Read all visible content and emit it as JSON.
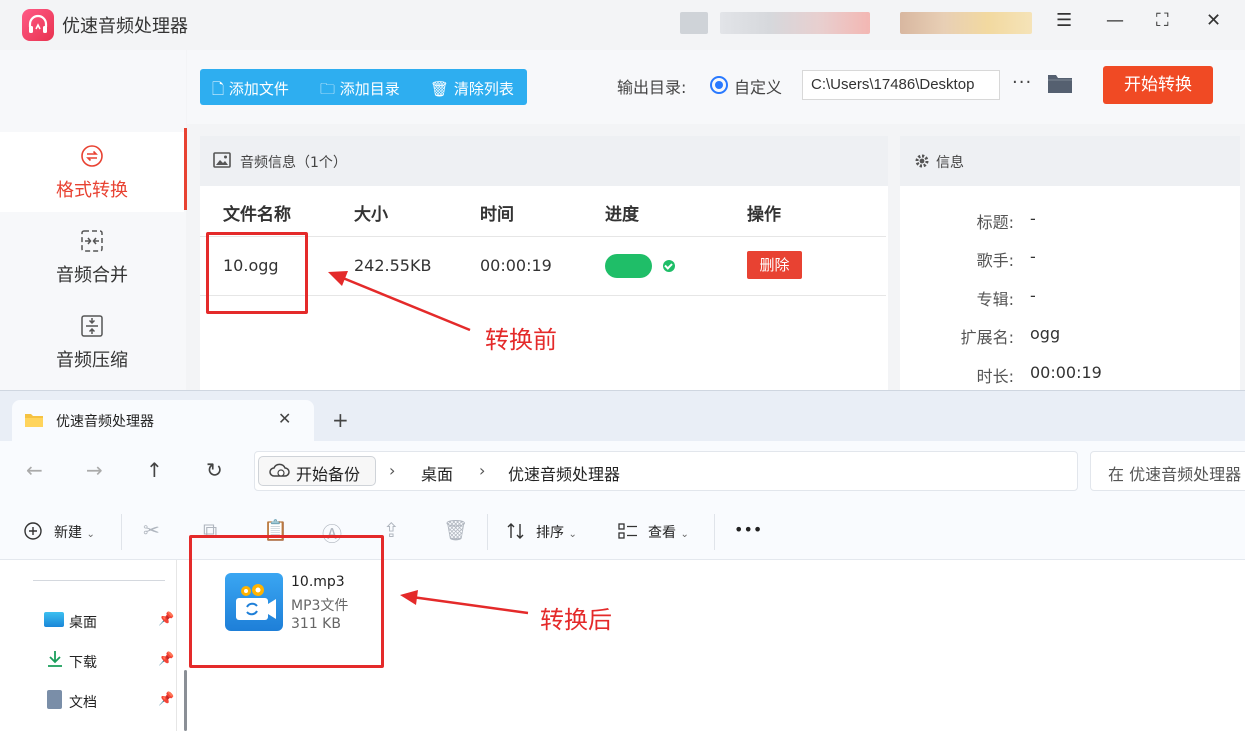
{
  "app": {
    "title": "优速音频处理器"
  },
  "sidebar": {
    "items": [
      {
        "label": "格式转换",
        "icon": "swap-circle-icon",
        "active": true
      },
      {
        "label": "音频合并",
        "icon": "merge-icon",
        "active": false
      },
      {
        "label": "音频压缩",
        "icon": "compress-icon",
        "active": false
      }
    ]
  },
  "toolbar": {
    "add_file": "添加文件",
    "add_dir": "添加目录",
    "clear_list": "清除列表",
    "output_label": "输出目录:",
    "radio_label": "自定义",
    "output_path": "C:\\Users\\17486\\Desktop",
    "more": "···",
    "start": "开始转换"
  },
  "audio_panel": {
    "title": "音频信息（1个）",
    "columns": [
      "文件名称",
      "大小",
      "时间",
      "进度",
      "操作"
    ],
    "rows": [
      {
        "name": "10.ogg",
        "size": "242.55KB",
        "time": "00:00:19",
        "progress": 1.0,
        "action": "删除"
      }
    ]
  },
  "info_panel": {
    "title": "信息",
    "fields": [
      {
        "key": "标题:",
        "value": "-"
      },
      {
        "key": "歌手:",
        "value": "-"
      },
      {
        "key": "专辑:",
        "value": "-"
      },
      {
        "key": "扩展名:",
        "value": "ogg"
      },
      {
        "key": "时长:",
        "value": "00:00:19"
      }
    ]
  },
  "annotations": {
    "before": "转换前",
    "after": "转换后"
  },
  "explorer": {
    "tab_title": "优速音频处理器",
    "tab_close": "✕",
    "new_tab": "+",
    "breadcrumb_home": "开始备份",
    "breadcrumbs": [
      "桌面",
      "优速音频处理器"
    ],
    "search_placeholder": "在 优速音频处理器",
    "cmd": {
      "new": "新建",
      "sort": "排序",
      "view": "查看",
      "more": "•••"
    },
    "nav_items": [
      {
        "label": "桌面"
      },
      {
        "label": "下载"
      },
      {
        "label": "文档"
      }
    ],
    "file": {
      "name": "10.mp3",
      "type": "MP3文件",
      "size": "311 KB"
    }
  },
  "colors": {
    "accent_red": "#e84232",
    "toolbar_blue": "#2eaef0",
    "start_orange": "#f04a24",
    "progress_green": "#1fbe68",
    "annotation_red": "#e42a2a"
  }
}
